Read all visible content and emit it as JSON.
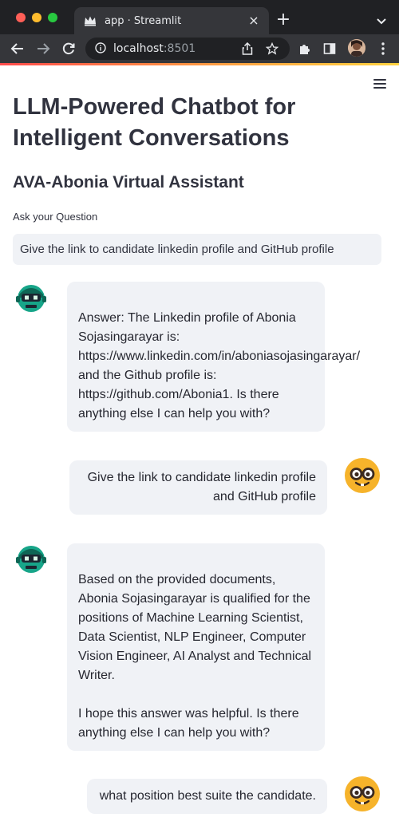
{
  "browser": {
    "tab_title": "app · Streamlit",
    "tab_close": "×",
    "new_tab": "+",
    "url_host": "localhost",
    "url_port": ":8501"
  },
  "page": {
    "title": "LLM-Powered Chatbot for Intelligent Conversations",
    "subtitle": "AVA-Abonia Virtual Assistant",
    "input_label": "Ask your Question",
    "input_value": "Give the link to candidate linkedin profile and GitHub profile"
  },
  "messages": [
    {
      "role": "bot",
      "avatar": "robot-avatar",
      "text": "\nAnswer: The Linkedin profile of Abonia Sojasingarayar is: https://www.linkedin.com/in/aboniasojasingarayar/ and the Github profile is: https://github.com/Abonia1. Is there anything else I can help you with?"
    },
    {
      "role": "user",
      "avatar": "nerd-face-avatar",
      "text": "Give the link to candidate linkedin profile and GitHub profile"
    },
    {
      "role": "bot",
      "avatar": "robot-avatar",
      "text": "\nBased on the provided documents, Abonia Sojasingarayar is qualified for the positions of Machine Learning Scientist, Data Scientist, NLP Engineer, Computer Vision Engineer, AI Analyst and Technical Writer.\n\nI hope this answer was helpful. Is there anything else I can help you with?"
    },
    {
      "role": "user",
      "avatar": "nerd-face-avatar",
      "text": "what position best suite the candidate."
    }
  ],
  "colors": {
    "accent": "#ff4b4b",
    "bubble_bg": "#f0f2f6",
    "text": "#31333f",
    "chrome_dark": "#202124"
  },
  "icons": [
    "close-traffic-light",
    "minimize-traffic-light",
    "zoom-traffic-light",
    "streamlit-crown-icon",
    "back-arrow-icon",
    "forward-arrow-icon",
    "reload-icon",
    "info-icon",
    "share-icon",
    "star-icon",
    "extensions-icon",
    "sidebar-icon",
    "more-vert-icon",
    "hamburger-menu-icon"
  ]
}
